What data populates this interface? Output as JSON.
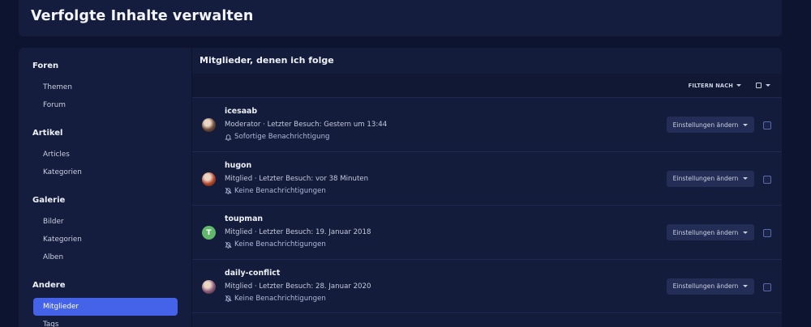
{
  "page": {
    "title": "Verfolgte Inhalte verwalten"
  },
  "sidebar": {
    "sections": [
      {
        "title": "Foren",
        "items": [
          "Themen",
          "Forum"
        ]
      },
      {
        "title": "Artikel",
        "items": [
          "Articles",
          "Kategorien"
        ]
      },
      {
        "title": "Galerie",
        "items": [
          "Bilder",
          "Kategorien",
          "Alben"
        ]
      },
      {
        "title": "Andere",
        "items": [
          "Mitglieder",
          "Tags"
        ],
        "active": "Mitglieder"
      }
    ]
  },
  "main": {
    "title": "Mitglieder, denen ich folge",
    "filter_label": "FILTERN NACH",
    "members": [
      {
        "name": "icesaab",
        "meta": "Moderator · Letzter Besuch: Gestern um 13:44",
        "notify": "Sofortige Benachrichtigung",
        "notify_icon": "bell-icon",
        "avatar": {
          "type": "photo",
          "color": "#6b4a3a"
        }
      },
      {
        "name": "hugon",
        "meta": "Mitglied · Letzter Besuch: vor 38 Minuten",
        "notify": "Keine Benachrichtigungen",
        "notify_icon": "bell-off-icon",
        "avatar": {
          "type": "photo",
          "color": "#b8462a"
        }
      },
      {
        "name": "toupman",
        "meta": "Mitglied · Letzter Besuch: 19. Januar 2018",
        "notify": "Keine Benachrichtigungen",
        "notify_icon": "bell-off-icon",
        "avatar": {
          "type": "letter",
          "letter": "T",
          "color": "#62b86a"
        }
      },
      {
        "name": "daily-conflict",
        "meta": "Mitglied · Letzter Besuch: 28. Januar 2020",
        "notify": "Keine Benachrichtigungen",
        "notify_icon": "bell-off-icon",
        "avatar": {
          "type": "photo",
          "color": "#8a5a7a"
        }
      }
    ],
    "settings_label": "Einstellungen ändern"
  }
}
